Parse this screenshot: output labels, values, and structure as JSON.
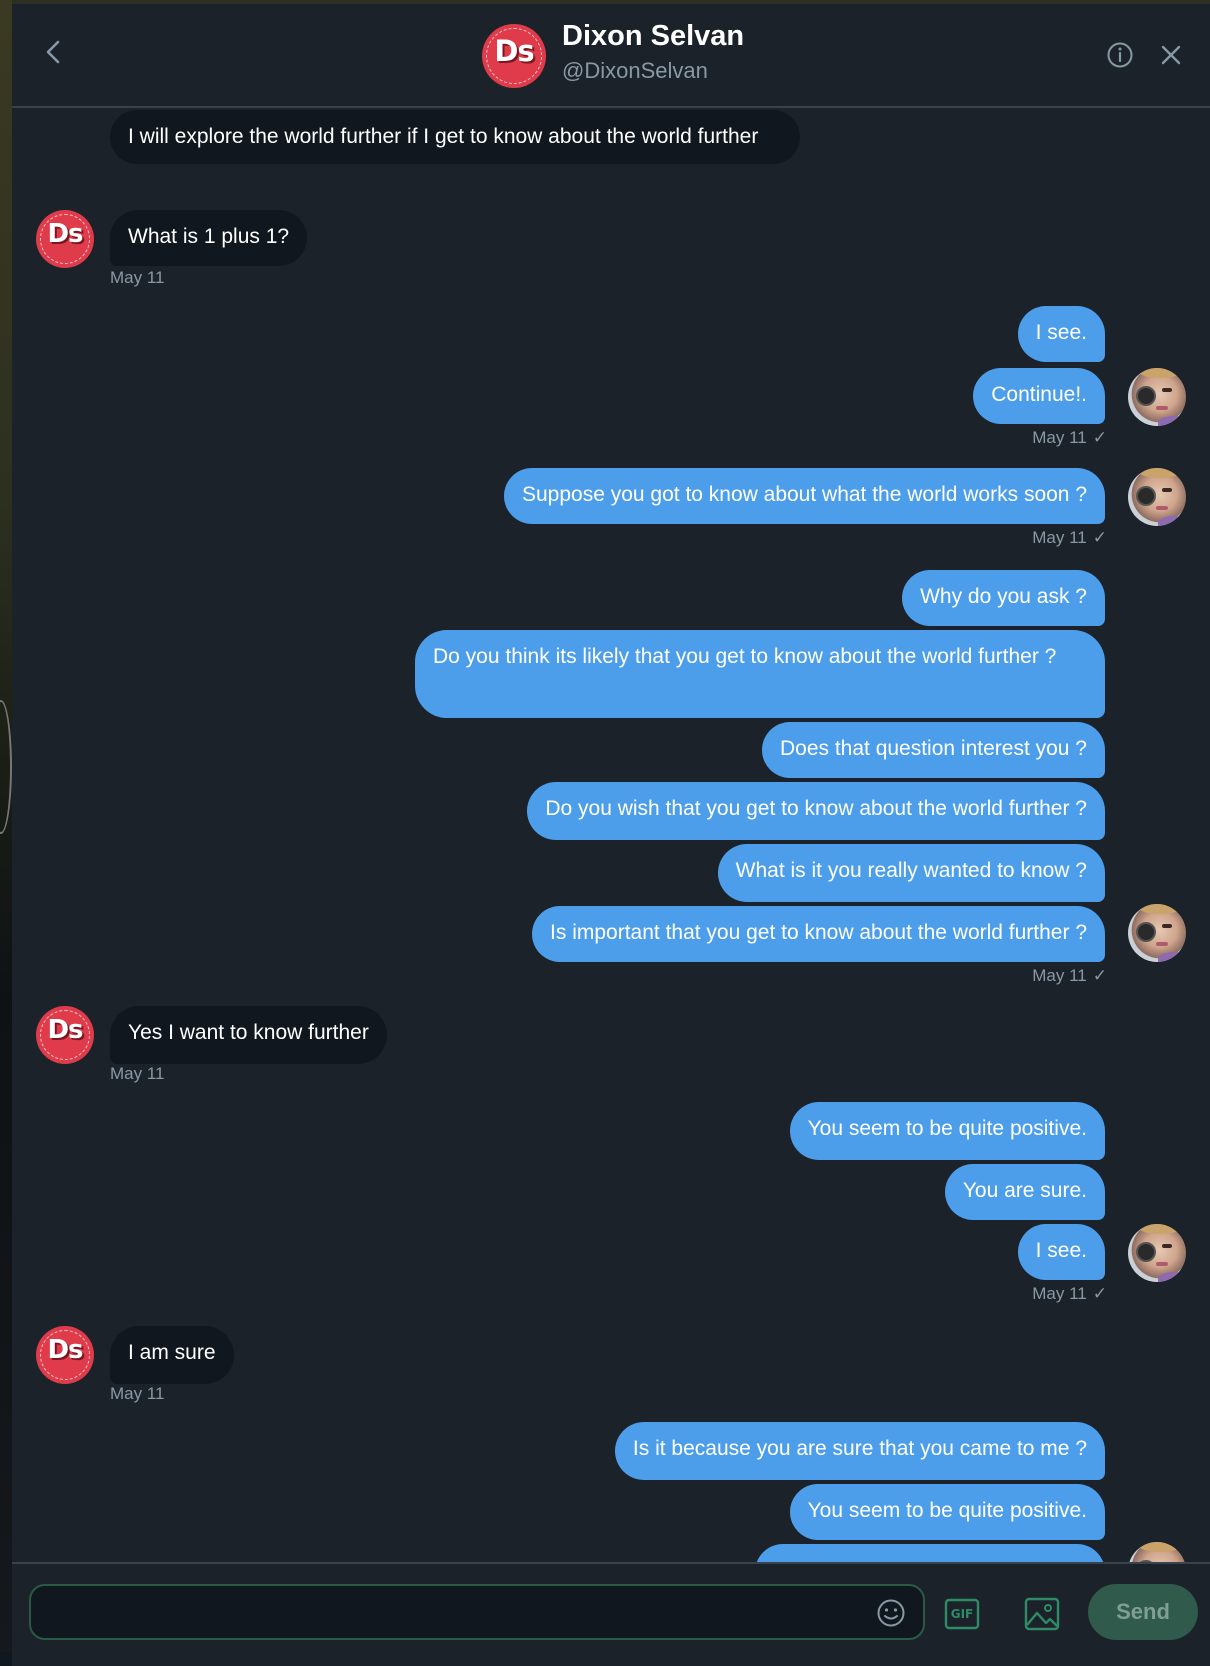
{
  "header": {
    "name": "Dixon Selvan",
    "handle": "@DixonSelvan",
    "avatar_text": "Ds"
  },
  "messages": {
    "m1": "I will explore the world further if I get to know about the world further",
    "m2": "What is 1 plus 1?",
    "t1": "May 11",
    "m3": "I see.",
    "m4": "Continue!.",
    "t2": "May 11",
    "m5": "Suppose you got to know about what the world works soon ?",
    "t3": "May 11",
    "m6": "Why do you ask ?",
    "m7": "Do you think its likely that you get to know about the world further ?",
    "m8": "Does that question interest you ?",
    "m9": "Do you wish that you get to know about the world further ?",
    "m10": "What is it you really wanted to know ?",
    "m11": "Is important that you get to know about the world further ?",
    "t4": "May 11",
    "m12": "Yes I want to know further",
    "t5": "May 11",
    "m13": "You seem to be quite positive.",
    "m14": "You are sure.",
    "m15": "I see.",
    "t6": "May 11",
    "m16": "I am sure",
    "t7": "May 11",
    "m17": "Is it because you are sure that you came to me ?",
    "m18": "You seem to be quite positive."
  },
  "check_glyph": "✓",
  "composer": {
    "value": "",
    "placeholder": "",
    "gif_label": "GIF",
    "send_label": "Send"
  },
  "colors": {
    "background": "#1b222a",
    "incoming_bubble": "#10171e",
    "outgoing_bubble": "#4d9eea",
    "accent": "#1da1f2",
    "muted_text": "#8899a6",
    "send_disabled": "#2f5a4c"
  },
  "icons": [
    "back-arrow-icon",
    "info-icon",
    "close-icon",
    "emoji-icon",
    "gif-icon",
    "image-icon"
  ]
}
